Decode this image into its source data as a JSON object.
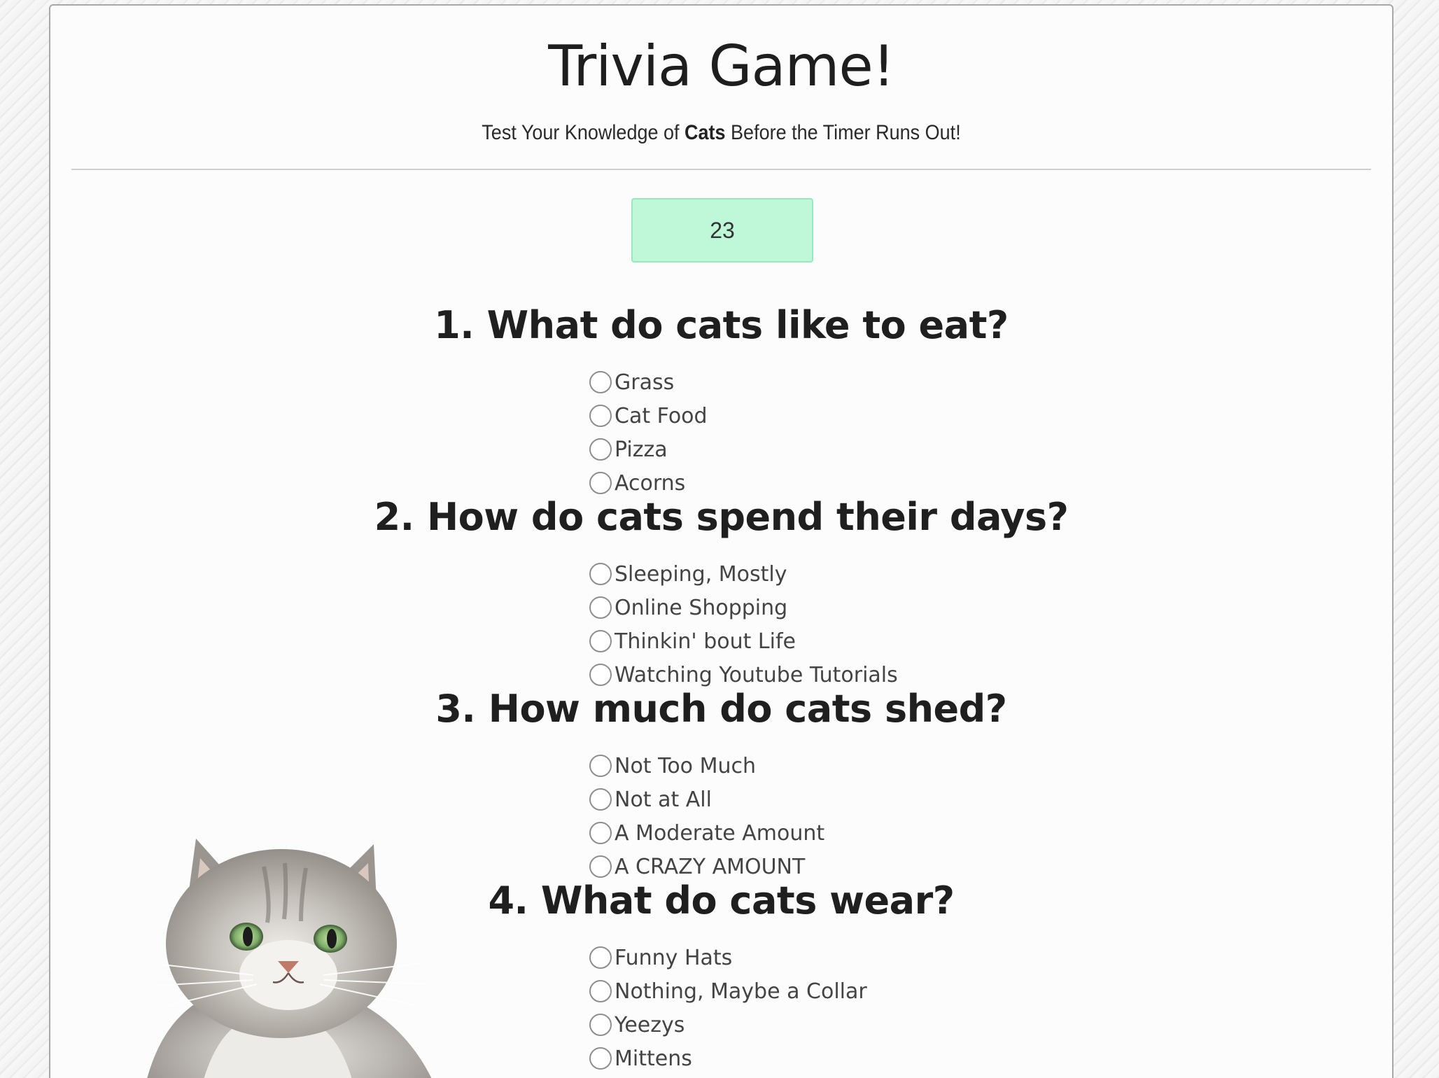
{
  "header": {
    "title": "Trivia Game!",
    "subtitle_before": "Test Your Knowledge of ",
    "subtitle_bold": "Cats",
    "subtitle_after": " Before the Timer Runs Out!"
  },
  "timer": {
    "value": "23"
  },
  "questions": [
    {
      "text": "1. What do cats like to eat?",
      "options": [
        "Grass",
        "Cat Food",
        "Pizza",
        "Acorns"
      ]
    },
    {
      "text": "2. How do cats spend their days?",
      "options": [
        "Sleeping, Mostly",
        "Online Shopping",
        "Thinkin' bout Life",
        "Watching Youtube Tutorials"
      ]
    },
    {
      "text": "3. How much do cats shed?",
      "options": [
        "Not Too Much",
        "Not at All",
        "A Moderate Amount",
        "A CRAZY AMOUNT"
      ]
    },
    {
      "text": "4. What do cats wear?",
      "options": [
        "Funny Hats",
        "Nothing, Maybe a Collar",
        "Yeezys",
        "Mittens"
      ]
    }
  ],
  "colors": {
    "timer_bg": "#bff7d9",
    "timer_border": "#98e8bd",
    "card_bg": "#fcfcfc"
  }
}
